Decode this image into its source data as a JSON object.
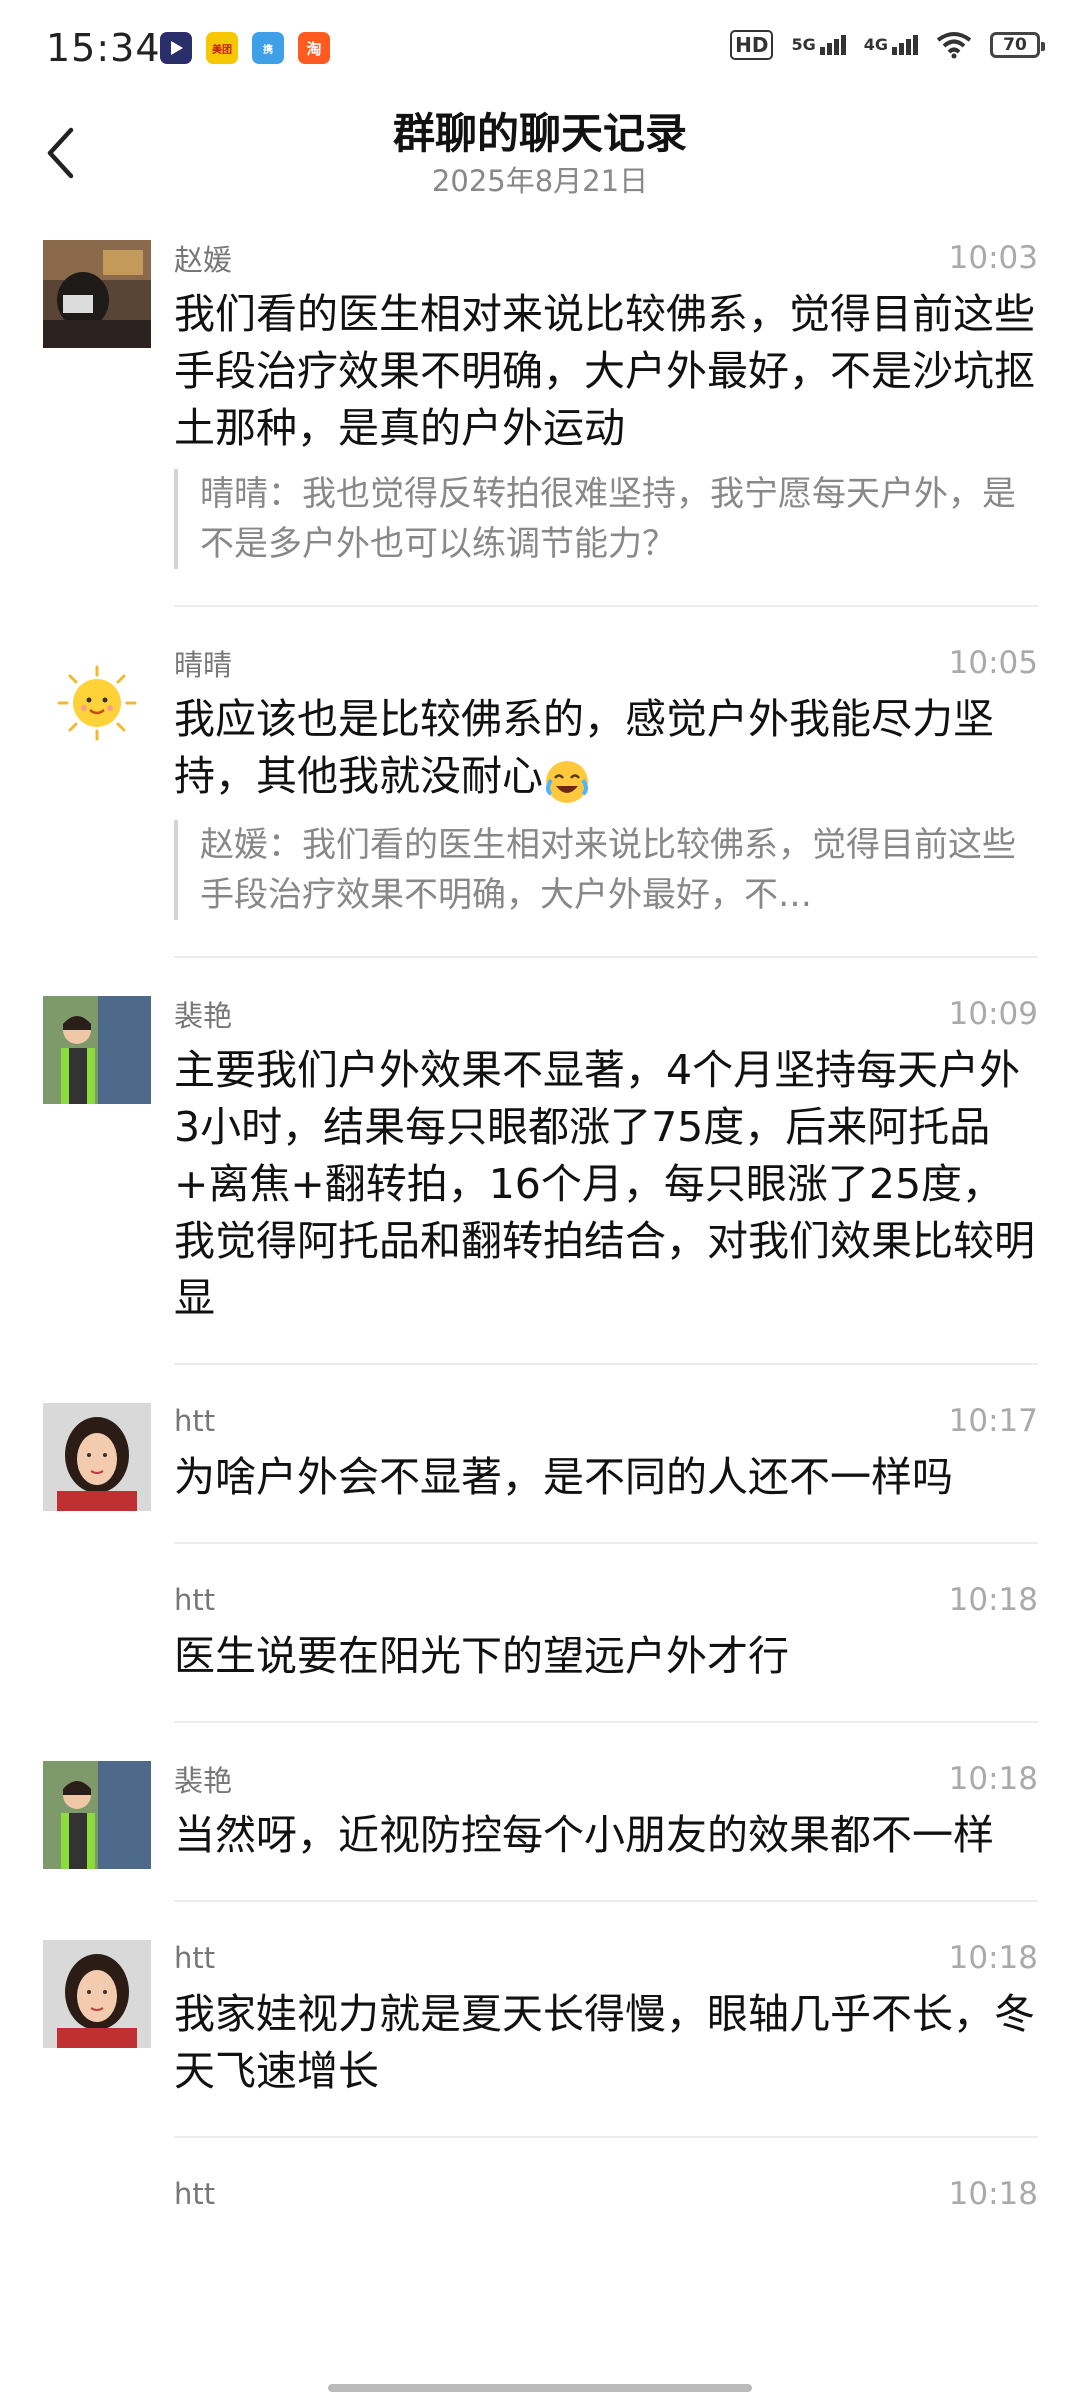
{
  "status": {
    "time": "15:34",
    "app_icons": [
      "video-app-icon",
      "meituan-app-icon",
      "ctrip-app-icon",
      "taobao-app-icon"
    ],
    "hd": "HD",
    "net1": "5G",
    "net2": "4G",
    "battery": "70"
  },
  "header": {
    "title": "群聊的聊天记录",
    "date": "2025年8月21日"
  },
  "messages": [
    {
      "sender": "赵媛",
      "time": "10:03",
      "avatar": "avatar-zhaoyuan",
      "text": "我们看的医生相对来说比较佛系，觉得目前这些手段治疗效果不明确，大户外最好，不是沙坑抠土那种，是真的户外运动",
      "quote": "晴晴：我也觉得反转拍很难坚持，我宁愿每天户外，是不是多户外也可以练调节能力？"
    },
    {
      "sender": "晴晴",
      "time": "10:05",
      "avatar": "avatar-qingqing",
      "text": "我应该也是比较佛系的，感觉户外我能尽力坚持，其他我就没耐心",
      "emoji": "laughing-crying-emoji",
      "quote": "赵媛：我们看的医生相对来说比较佛系，觉得目前这些手段治疗效果不明确，大户外最好，不…"
    },
    {
      "sender": "裴艳",
      "time": "10:09",
      "avatar": "avatar-peiyan",
      "text": "主要我们户外效果不显著，4个月坚持每天户外3小时，结果每只眼都涨了75度，后来阿托品+离焦+翻转拍，16个月，每只眼涨了25度，我觉得阿托品和翻转拍结合，对我们效果比较明显"
    },
    {
      "sender": "htt",
      "time": "10:17",
      "avatar": "avatar-htt",
      "text": "为啥户外会不显著，是不同的人还不一样吗"
    },
    {
      "sender": "htt",
      "time": "10:18",
      "avatar": "",
      "text": "医生说要在阳光下的望远户外才行"
    },
    {
      "sender": "裴艳",
      "time": "10:18",
      "avatar": "avatar-peiyan",
      "text": "当然呀，近视防控每个小朋友的效果都不一样"
    },
    {
      "sender": "htt",
      "time": "10:18",
      "avatar": "avatar-htt",
      "text": "我家娃视力就是夏天长得慢，眼轴几乎不长，冬天飞速增长"
    },
    {
      "sender": "htt",
      "time": "10:18",
      "avatar": "",
      "text": ""
    }
  ]
}
